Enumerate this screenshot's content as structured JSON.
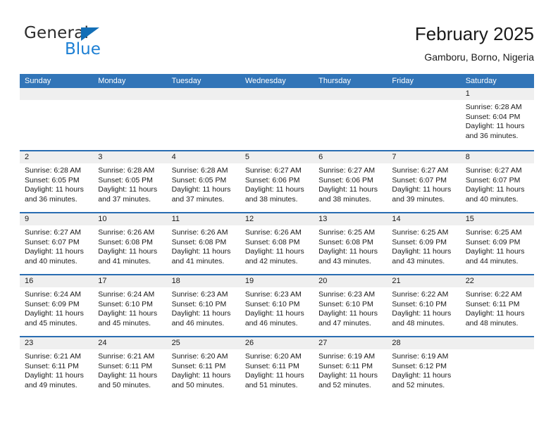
{
  "brand": {
    "name_top": "General",
    "name_bottom": "Blue",
    "triangle_color": "#136fb7",
    "blue_color": "#1c7fd4"
  },
  "header": {
    "title": "February 2025",
    "subtitle": "Gamboru, Borno, Nigeria"
  },
  "colors": {
    "header_blue": "#3275b8",
    "row_divider": "#2a6db2",
    "daynum_band": "#efefef",
    "text": "#1a1a1a"
  },
  "weekdays": [
    "Sunday",
    "Monday",
    "Tuesday",
    "Wednesday",
    "Thursday",
    "Friday",
    "Saturday"
  ],
  "weeks": [
    [
      {
        "day": ""
      },
      {
        "day": ""
      },
      {
        "day": ""
      },
      {
        "day": ""
      },
      {
        "day": ""
      },
      {
        "day": ""
      },
      {
        "day": "1",
        "sunrise": "Sunrise: 6:28 AM",
        "sunset": "Sunset: 6:04 PM",
        "daylight": "Daylight: 11 hours and 36 minutes."
      }
    ],
    [
      {
        "day": "2",
        "sunrise": "Sunrise: 6:28 AM",
        "sunset": "Sunset: 6:05 PM",
        "daylight": "Daylight: 11 hours and 36 minutes."
      },
      {
        "day": "3",
        "sunrise": "Sunrise: 6:28 AM",
        "sunset": "Sunset: 6:05 PM",
        "daylight": "Daylight: 11 hours and 37 minutes."
      },
      {
        "day": "4",
        "sunrise": "Sunrise: 6:28 AM",
        "sunset": "Sunset: 6:05 PM",
        "daylight": "Daylight: 11 hours and 37 minutes."
      },
      {
        "day": "5",
        "sunrise": "Sunrise: 6:27 AM",
        "sunset": "Sunset: 6:06 PM",
        "daylight": "Daylight: 11 hours and 38 minutes."
      },
      {
        "day": "6",
        "sunrise": "Sunrise: 6:27 AM",
        "sunset": "Sunset: 6:06 PM",
        "daylight": "Daylight: 11 hours and 38 minutes."
      },
      {
        "day": "7",
        "sunrise": "Sunrise: 6:27 AM",
        "sunset": "Sunset: 6:07 PM",
        "daylight": "Daylight: 11 hours and 39 minutes."
      },
      {
        "day": "8",
        "sunrise": "Sunrise: 6:27 AM",
        "sunset": "Sunset: 6:07 PM",
        "daylight": "Daylight: 11 hours and 40 minutes."
      }
    ],
    [
      {
        "day": "9",
        "sunrise": "Sunrise: 6:27 AM",
        "sunset": "Sunset: 6:07 PM",
        "daylight": "Daylight: 11 hours and 40 minutes."
      },
      {
        "day": "10",
        "sunrise": "Sunrise: 6:26 AM",
        "sunset": "Sunset: 6:08 PM",
        "daylight": "Daylight: 11 hours and 41 minutes."
      },
      {
        "day": "11",
        "sunrise": "Sunrise: 6:26 AM",
        "sunset": "Sunset: 6:08 PM",
        "daylight": "Daylight: 11 hours and 41 minutes."
      },
      {
        "day": "12",
        "sunrise": "Sunrise: 6:26 AM",
        "sunset": "Sunset: 6:08 PM",
        "daylight": "Daylight: 11 hours and 42 minutes."
      },
      {
        "day": "13",
        "sunrise": "Sunrise: 6:25 AM",
        "sunset": "Sunset: 6:08 PM",
        "daylight": "Daylight: 11 hours and 43 minutes."
      },
      {
        "day": "14",
        "sunrise": "Sunrise: 6:25 AM",
        "sunset": "Sunset: 6:09 PM",
        "daylight": "Daylight: 11 hours and 43 minutes."
      },
      {
        "day": "15",
        "sunrise": "Sunrise: 6:25 AM",
        "sunset": "Sunset: 6:09 PM",
        "daylight": "Daylight: 11 hours and 44 minutes."
      }
    ],
    [
      {
        "day": "16",
        "sunrise": "Sunrise: 6:24 AM",
        "sunset": "Sunset: 6:09 PM",
        "daylight": "Daylight: 11 hours and 45 minutes."
      },
      {
        "day": "17",
        "sunrise": "Sunrise: 6:24 AM",
        "sunset": "Sunset: 6:10 PM",
        "daylight": "Daylight: 11 hours and 45 minutes."
      },
      {
        "day": "18",
        "sunrise": "Sunrise: 6:23 AM",
        "sunset": "Sunset: 6:10 PM",
        "daylight": "Daylight: 11 hours and 46 minutes."
      },
      {
        "day": "19",
        "sunrise": "Sunrise: 6:23 AM",
        "sunset": "Sunset: 6:10 PM",
        "daylight": "Daylight: 11 hours and 46 minutes."
      },
      {
        "day": "20",
        "sunrise": "Sunrise: 6:23 AM",
        "sunset": "Sunset: 6:10 PM",
        "daylight": "Daylight: 11 hours and 47 minutes."
      },
      {
        "day": "21",
        "sunrise": "Sunrise: 6:22 AM",
        "sunset": "Sunset: 6:10 PM",
        "daylight": "Daylight: 11 hours and 48 minutes."
      },
      {
        "day": "22",
        "sunrise": "Sunrise: 6:22 AM",
        "sunset": "Sunset: 6:11 PM",
        "daylight": "Daylight: 11 hours and 48 minutes."
      }
    ],
    [
      {
        "day": "23",
        "sunrise": "Sunrise: 6:21 AM",
        "sunset": "Sunset: 6:11 PM",
        "daylight": "Daylight: 11 hours and 49 minutes."
      },
      {
        "day": "24",
        "sunrise": "Sunrise: 6:21 AM",
        "sunset": "Sunset: 6:11 PM",
        "daylight": "Daylight: 11 hours and 50 minutes."
      },
      {
        "day": "25",
        "sunrise": "Sunrise: 6:20 AM",
        "sunset": "Sunset: 6:11 PM",
        "daylight": "Daylight: 11 hours and 50 minutes."
      },
      {
        "day": "26",
        "sunrise": "Sunrise: 6:20 AM",
        "sunset": "Sunset: 6:11 PM",
        "daylight": "Daylight: 11 hours and 51 minutes."
      },
      {
        "day": "27",
        "sunrise": "Sunrise: 6:19 AM",
        "sunset": "Sunset: 6:11 PM",
        "daylight": "Daylight: 11 hours and 52 minutes."
      },
      {
        "day": "28",
        "sunrise": "Sunrise: 6:19 AM",
        "sunset": "Sunset: 6:12 PM",
        "daylight": "Daylight: 11 hours and 52 minutes."
      },
      {
        "day": ""
      }
    ]
  ]
}
